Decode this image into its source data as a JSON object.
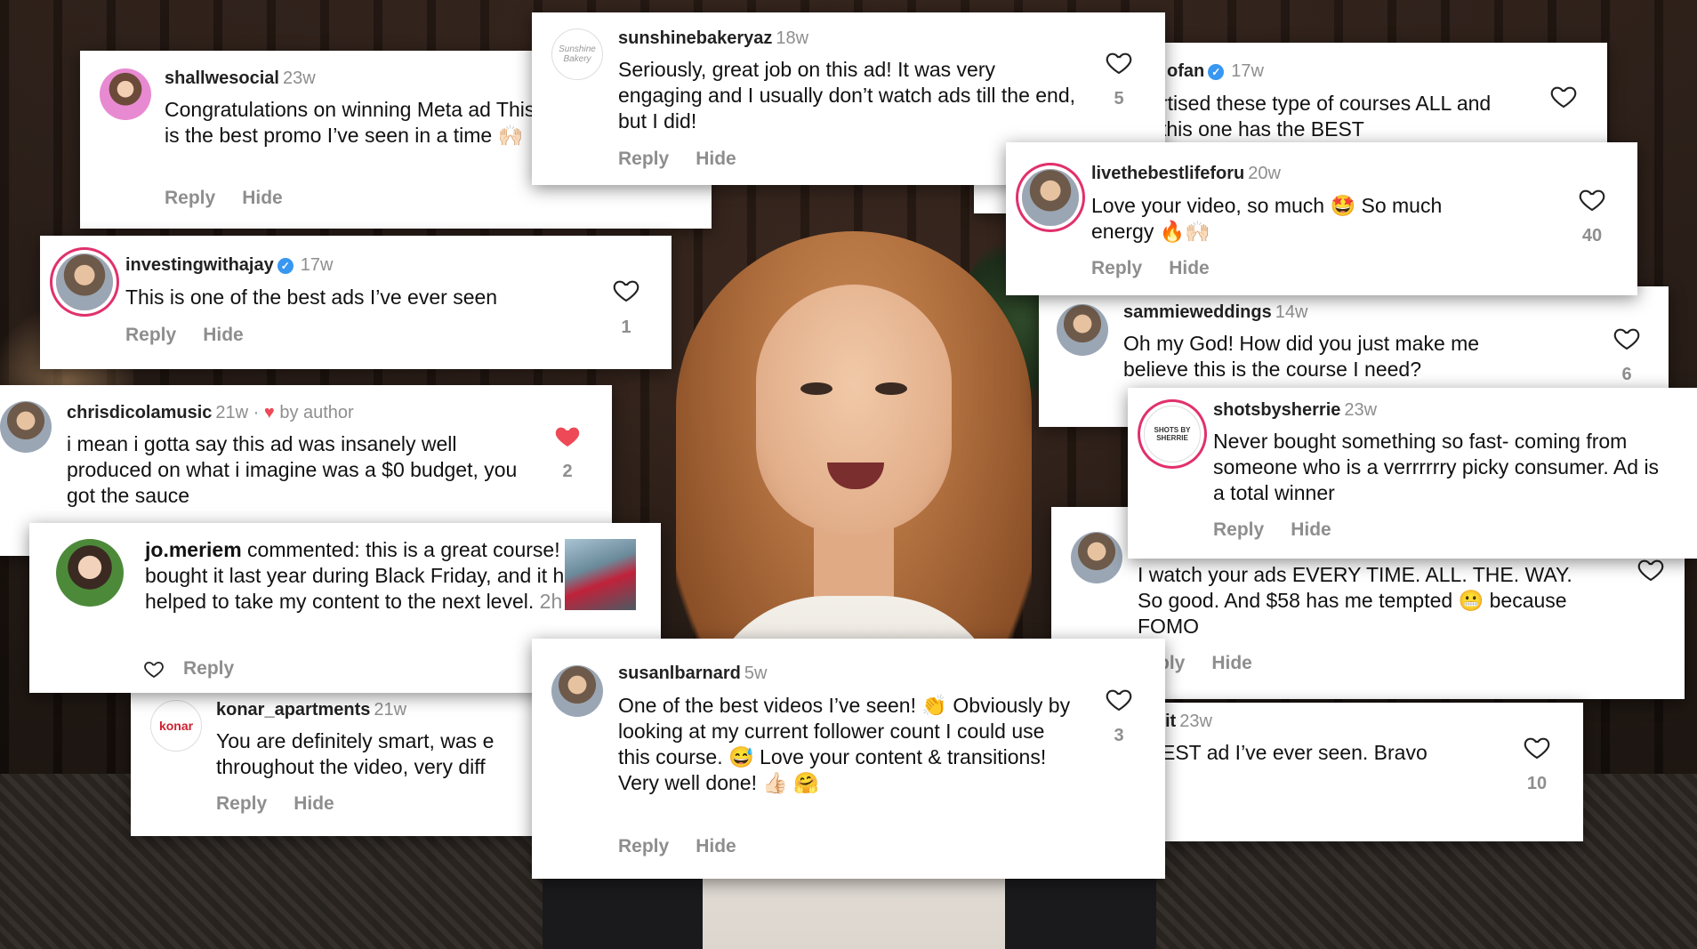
{
  "comments": [
    {
      "id": "c1",
      "user": "shallwesocial",
      "time": "23w",
      "text": "Congratulations on winning Meta ad This is the best promo I’ve seen in a time 🙌🏻",
      "reply": "Reply",
      "hide": "Hide"
    },
    {
      "id": "c2",
      "user": "sunshinebakeryaz",
      "time": "18w",
      "text": "Seriously, great job on this ad! It was very engaging and I usually don’t watch ads till the end, but I did!",
      "reply": "Reply",
      "hide": "Hide",
      "likes": "5",
      "avatar_text": "Sunshine Bakery"
    },
    {
      "id": "c3",
      "user": "ofan",
      "time": "17w",
      "text": "rtised these type of courses ALL and this one has the BEST",
      "verified": true
    },
    {
      "id": "c4",
      "user": "livethebestlifeforu",
      "time": "20w",
      "text": "Love your video, so much 🤩 So much energy 🔥🙌🏻",
      "reply": "Reply",
      "hide": "Hide",
      "likes": "40"
    },
    {
      "id": "c5",
      "user": "investingwithajay",
      "time": "17w",
      "text": "This is one of the best ads I’ve ever seen",
      "reply": "Reply",
      "hide": "Hide",
      "likes": "1",
      "verified": true
    },
    {
      "id": "c6",
      "user": "sammieweddings",
      "time": "14w",
      "text": "Oh my God! How did you just make me believe this is the course I need?",
      "likes": "6"
    },
    {
      "id": "c7",
      "user": "chrisdicolamusic",
      "time": "21w",
      "byauthor": "by author",
      "text": "i mean i gotta say this ad was insanely well produced on what i imagine was a $0 budget, you got the sauce",
      "likes": "2"
    },
    {
      "id": "c8",
      "user": "shotsbysherrie",
      "time": "23w",
      "text": "Never bought something so fast- coming from someone who is a verrrrrry picky consumer. Ad is a total winner",
      "reply": "Reply",
      "hide": "Hide",
      "avatar_text": "SHOTS BY SHERRIE"
    },
    {
      "id": "c9",
      "user": "jo.meriem",
      "commented": "commented:",
      "text": "this is a great course! I bought it last year during Black Friday, and it has helped to take my content to the next level.",
      "time": "2h",
      "reply": "Reply"
    },
    {
      "id": "c10",
      "user": "",
      "text": "I watch your ads EVERY TIME. ALL. THE. WAY. So good. And $58 has me tempted 😬 because FOMO",
      "reply": "ply",
      "hide": "Hide"
    },
    {
      "id": "c11",
      "user": "konar_apartments",
      "time": "21w",
      "text": "You are definitely smart, was e throughout the video, very diff",
      "reply": "Reply",
      "hide": "Hide",
      "avatar_text": "konar"
    },
    {
      "id": "c12",
      "user": "susanlbarnard",
      "time": "5w",
      "text": "One of the best videos I’ve seen! 👏 Obviously by looking at my current follower count  I could use this course. 😅 Love your content & transitions!  Very well done! 👍🏻 🤗",
      "reply": "Reply",
      "hide": "Hide",
      "likes": "3"
    },
    {
      "id": "c13",
      "user": "it",
      "time": "23w",
      "text": "EST ad I’ve ever seen. Bravo",
      "likes": "10"
    }
  ],
  "colors": {
    "like_active": "#ed4956",
    "verified": "#3897f0",
    "muted": "#8e8e8e",
    "story_ring": "#e1306c"
  }
}
